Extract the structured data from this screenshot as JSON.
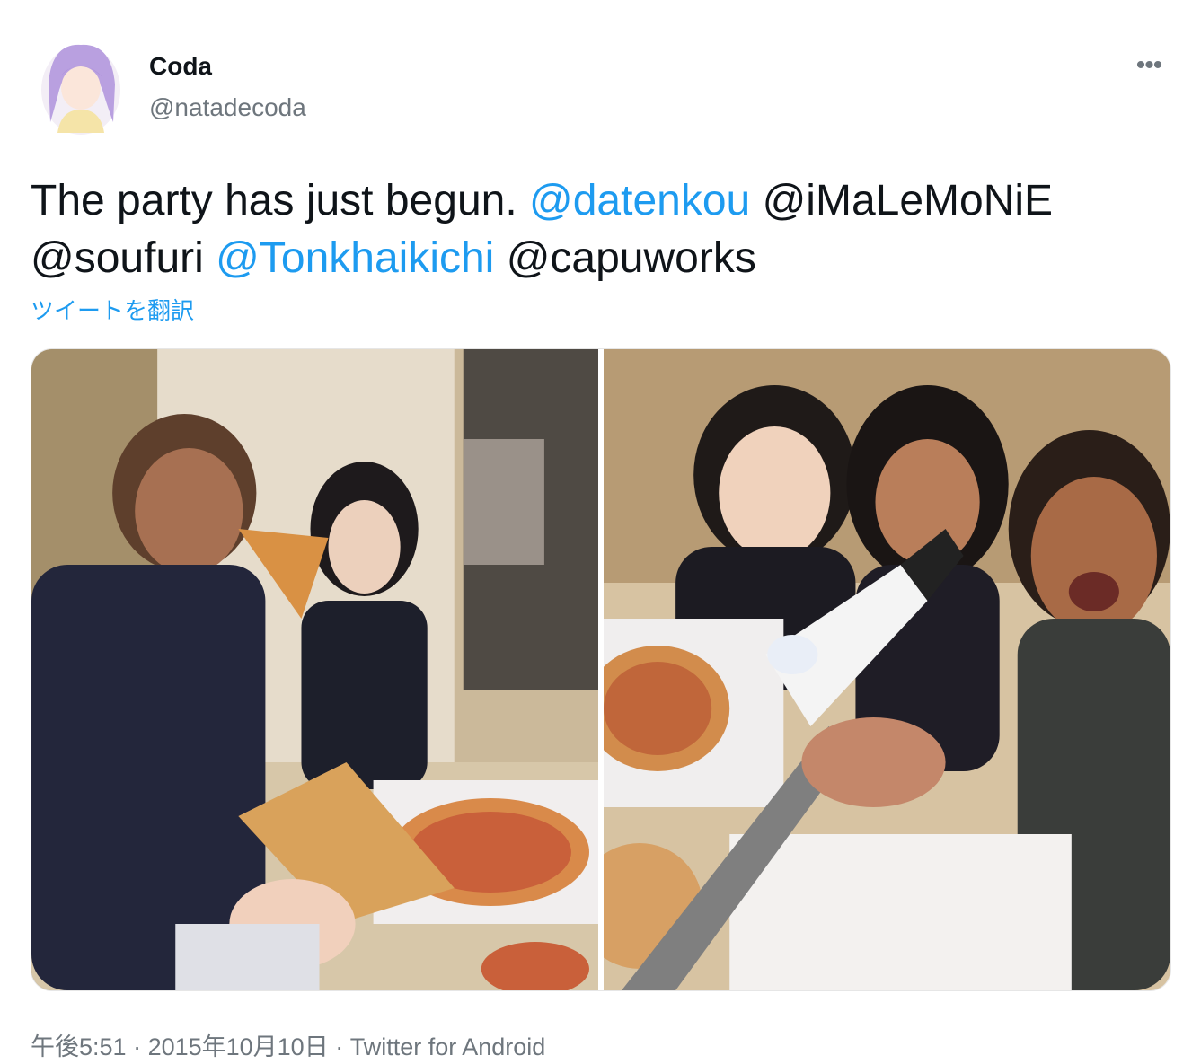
{
  "author": {
    "name": "Coda",
    "handle": "@natadecoda"
  },
  "more_icon": "more-horizontal-icon",
  "tweet": {
    "text_parts": [
      {
        "text": "The party has just begun. ",
        "kind": "plain"
      },
      {
        "text": "@datenkou",
        "kind": "link"
      },
      {
        "text": " ",
        "kind": "plain"
      },
      {
        "text": "@iMaLeMoNiE",
        "kind": "mention"
      },
      {
        "text": " ",
        "kind": "plain"
      },
      {
        "text": "@soufuri",
        "kind": "mention"
      },
      {
        "text": " ",
        "kind": "plain"
      },
      {
        "text": "@Tonkhaikichi",
        "kind": "link"
      },
      {
        "text": " ",
        "kind": "plain"
      },
      {
        "text": "@capuworks",
        "kind": "mention"
      }
    ],
    "translate_label": "ツイートを翻訳"
  },
  "footer": {
    "time": "午後5:51",
    "sep1": " · ",
    "date": "2015年10月10日",
    "sep2": " · ",
    "source": "Twitter for Android"
  },
  "colors": {
    "link": "#1d9bf0",
    "text": "#0f1419",
    "muted": "#6e767d"
  }
}
